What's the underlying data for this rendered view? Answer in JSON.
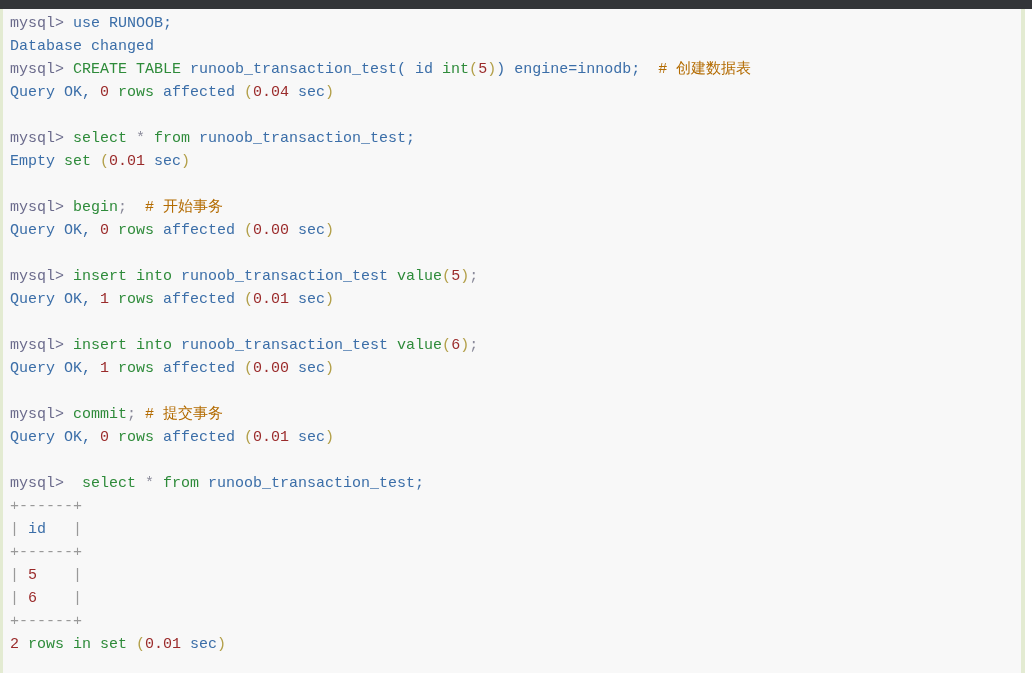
{
  "code_blocks": [
    {
      "lines": [
        {
          "tokens": [
            {
              "kind": "p",
              "text": "mysql> "
            },
            {
              "kind": "i",
              "text": "use RUNOOB;"
            }
          ]
        },
        {
          "tokens": [
            {
              "kind": "i",
              "text": "Database changed"
            }
          ]
        },
        {
          "tokens": [
            {
              "kind": "p",
              "text": "mysql> "
            },
            {
              "kind": "k",
              "text": "CREATE TABLE "
            },
            {
              "kind": "i",
              "text": "runoob_transaction_test( id "
            },
            {
              "kind": "k",
              "text": "int"
            },
            {
              "kind": "b",
              "text": "("
            },
            {
              "kind": "n",
              "text": "5"
            },
            {
              "kind": "b",
              "text": ")"
            },
            {
              "kind": "i",
              "text": ") engine=innodb;  "
            },
            {
              "kind": "c",
              "text": "# 创建数据表"
            }
          ]
        },
        {
          "tokens": [
            {
              "kind": "i",
              "text": "Query OK, "
            },
            {
              "kind": "n",
              "text": "0 "
            },
            {
              "kind": "k",
              "text": "rows "
            },
            {
              "kind": "i",
              "text": "affected "
            },
            {
              "kind": "b",
              "text": "("
            },
            {
              "kind": "n",
              "text": "0.04 "
            },
            {
              "kind": "i",
              "text": "sec"
            },
            {
              "kind": "b",
              "text": ")"
            }
          ]
        }
      ]
    },
    {
      "lines": [
        {
          "tokens": [
            {
              "kind": "p",
              "text": "mysql> "
            },
            {
              "kind": "k",
              "text": "select "
            },
            {
              "kind": "o",
              "text": "* "
            },
            {
              "kind": "k",
              "text": "from "
            },
            {
              "kind": "i",
              "text": "runoob_transaction_test;"
            }
          ]
        },
        {
          "tokens": [
            {
              "kind": "i",
              "text": "Empty "
            },
            {
              "kind": "k",
              "text": "set "
            },
            {
              "kind": "b",
              "text": "("
            },
            {
              "kind": "n",
              "text": "0.01 "
            },
            {
              "kind": "i",
              "text": "sec"
            },
            {
              "kind": "b",
              "text": ")"
            }
          ]
        }
      ]
    },
    {
      "lines": [
        {
          "tokens": [
            {
              "kind": "p",
              "text": "mysql> "
            },
            {
              "kind": "k",
              "text": "begin"
            },
            {
              "kind": "o",
              "text": ";  "
            },
            {
              "kind": "c",
              "text": "# 开始事务"
            }
          ]
        },
        {
          "tokens": [
            {
              "kind": "i",
              "text": "Query OK, "
            },
            {
              "kind": "n",
              "text": "0 "
            },
            {
              "kind": "k",
              "text": "rows "
            },
            {
              "kind": "i",
              "text": "affected "
            },
            {
              "kind": "b",
              "text": "("
            },
            {
              "kind": "n",
              "text": "0.00 "
            },
            {
              "kind": "i",
              "text": "sec"
            },
            {
              "kind": "b",
              "text": ")"
            }
          ]
        }
      ]
    },
    {
      "lines": [
        {
          "tokens": [
            {
              "kind": "p",
              "text": "mysql> "
            },
            {
              "kind": "k",
              "text": "insert into "
            },
            {
              "kind": "i",
              "text": "runoob_transaction_test "
            },
            {
              "kind": "k",
              "text": "value"
            },
            {
              "kind": "b",
              "text": "("
            },
            {
              "kind": "n",
              "text": "5"
            },
            {
              "kind": "b",
              "text": ")"
            },
            {
              "kind": "o",
              "text": ";"
            }
          ]
        },
        {
          "tokens": [
            {
              "kind": "i",
              "text": "Query OK, "
            },
            {
              "kind": "n",
              "text": "1 "
            },
            {
              "kind": "k",
              "text": "rows "
            },
            {
              "kind": "i",
              "text": "affected "
            },
            {
              "kind": "b",
              "text": "("
            },
            {
              "kind": "n",
              "text": "0.01 "
            },
            {
              "kind": "i",
              "text": "sec"
            },
            {
              "kind": "b",
              "text": ")"
            }
          ]
        }
      ]
    },
    {
      "lines": [
        {
          "tokens": [
            {
              "kind": "p",
              "text": "mysql> "
            },
            {
              "kind": "k",
              "text": "insert into "
            },
            {
              "kind": "i",
              "text": "runoob_transaction_test "
            },
            {
              "kind": "k",
              "text": "value"
            },
            {
              "kind": "b",
              "text": "("
            },
            {
              "kind": "n",
              "text": "6"
            },
            {
              "kind": "b",
              "text": ")"
            },
            {
              "kind": "o",
              "text": ";"
            }
          ]
        },
        {
          "tokens": [
            {
              "kind": "i",
              "text": "Query OK, "
            },
            {
              "kind": "n",
              "text": "1 "
            },
            {
              "kind": "k",
              "text": "rows "
            },
            {
              "kind": "i",
              "text": "affected "
            },
            {
              "kind": "b",
              "text": "("
            },
            {
              "kind": "n",
              "text": "0.00 "
            },
            {
              "kind": "i",
              "text": "sec"
            },
            {
              "kind": "b",
              "text": ")"
            }
          ]
        }
      ]
    },
    {
      "lines": [
        {
          "tokens": [
            {
              "kind": "p",
              "text": "mysql> "
            },
            {
              "kind": "k",
              "text": "commit"
            },
            {
              "kind": "o",
              "text": "; "
            },
            {
              "kind": "c",
              "text": "# 提交事务"
            }
          ]
        },
        {
          "tokens": [
            {
              "kind": "i",
              "text": "Query OK, "
            },
            {
              "kind": "n",
              "text": "0 "
            },
            {
              "kind": "k",
              "text": "rows "
            },
            {
              "kind": "i",
              "text": "affected "
            },
            {
              "kind": "b",
              "text": "("
            },
            {
              "kind": "n",
              "text": "0.01 "
            },
            {
              "kind": "i",
              "text": "sec"
            },
            {
              "kind": "b",
              "text": ")"
            }
          ]
        }
      ]
    },
    {
      "lines": [
        {
          "tokens": [
            {
              "kind": "p",
              "text": "mysql>  "
            },
            {
              "kind": "k",
              "text": "select "
            },
            {
              "kind": "o",
              "text": "* "
            },
            {
              "kind": "k",
              "text": "from "
            },
            {
              "kind": "i",
              "text": "runoob_transaction_test;"
            }
          ]
        },
        {
          "tokens": [
            {
              "kind": "t",
              "text": "+------+"
            }
          ]
        },
        {
          "tokens": [
            {
              "kind": "t",
              "text": "| "
            },
            {
              "kind": "i",
              "text": "id"
            },
            {
              "kind": "t",
              "text": "   |"
            }
          ]
        },
        {
          "tokens": [
            {
              "kind": "t",
              "text": "+------+"
            }
          ]
        },
        {
          "tokens": [
            {
              "kind": "t",
              "text": "| "
            },
            {
              "kind": "n",
              "text": "5"
            },
            {
              "kind": "t",
              "text": "    |"
            }
          ]
        },
        {
          "tokens": [
            {
              "kind": "t",
              "text": "| "
            },
            {
              "kind": "n",
              "text": "6"
            },
            {
              "kind": "t",
              "text": "    |"
            }
          ]
        },
        {
          "tokens": [
            {
              "kind": "t",
              "text": "+------+"
            }
          ]
        },
        {
          "tokens": [
            {
              "kind": "n",
              "text": "2 "
            },
            {
              "kind": "k",
              "text": "rows in set "
            },
            {
              "kind": "b",
              "text": "("
            },
            {
              "kind": "n",
              "text": "0.01 "
            },
            {
              "kind": "i",
              "text": "sec"
            },
            {
              "kind": "b",
              "text": ")"
            }
          ]
        }
      ]
    }
  ]
}
